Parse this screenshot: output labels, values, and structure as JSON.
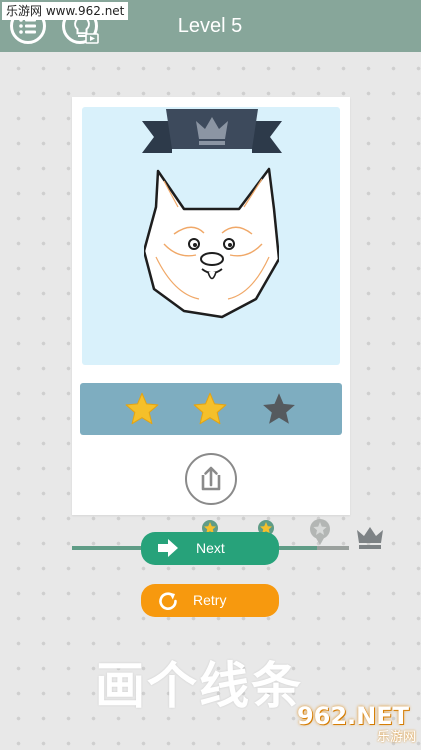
{
  "header": {
    "watermark": "乐游网 www.962.net",
    "menu_icon": "list-menu-icon",
    "hint_icon": "lightbulb-video-icon",
    "title": "Level 5"
  },
  "result_card": {
    "drawing": "shiba-dog-face",
    "badge_icon": "crown-icon",
    "stars": {
      "earned": 2,
      "total": 3
    },
    "share_icon": "share-icon"
  },
  "progress": {
    "milestones": [
      "star-badge-icon",
      "star-badge-icon",
      "locked-badge-icon",
      "crown-icon"
    ],
    "completed_fraction": 0.88
  },
  "buttons": {
    "next_label": "Next",
    "retry_label": "Retry"
  },
  "caption": "画个线条",
  "watermark_logo": {
    "big": "962.NET",
    "small": "乐游网"
  },
  "colors": {
    "header": "#87a69a",
    "next": "#27a27a",
    "retry": "#f7990e",
    "stars_bar": "#7eadc0",
    "star_gold": "#f5c02a",
    "star_empty": "#555a5e"
  }
}
